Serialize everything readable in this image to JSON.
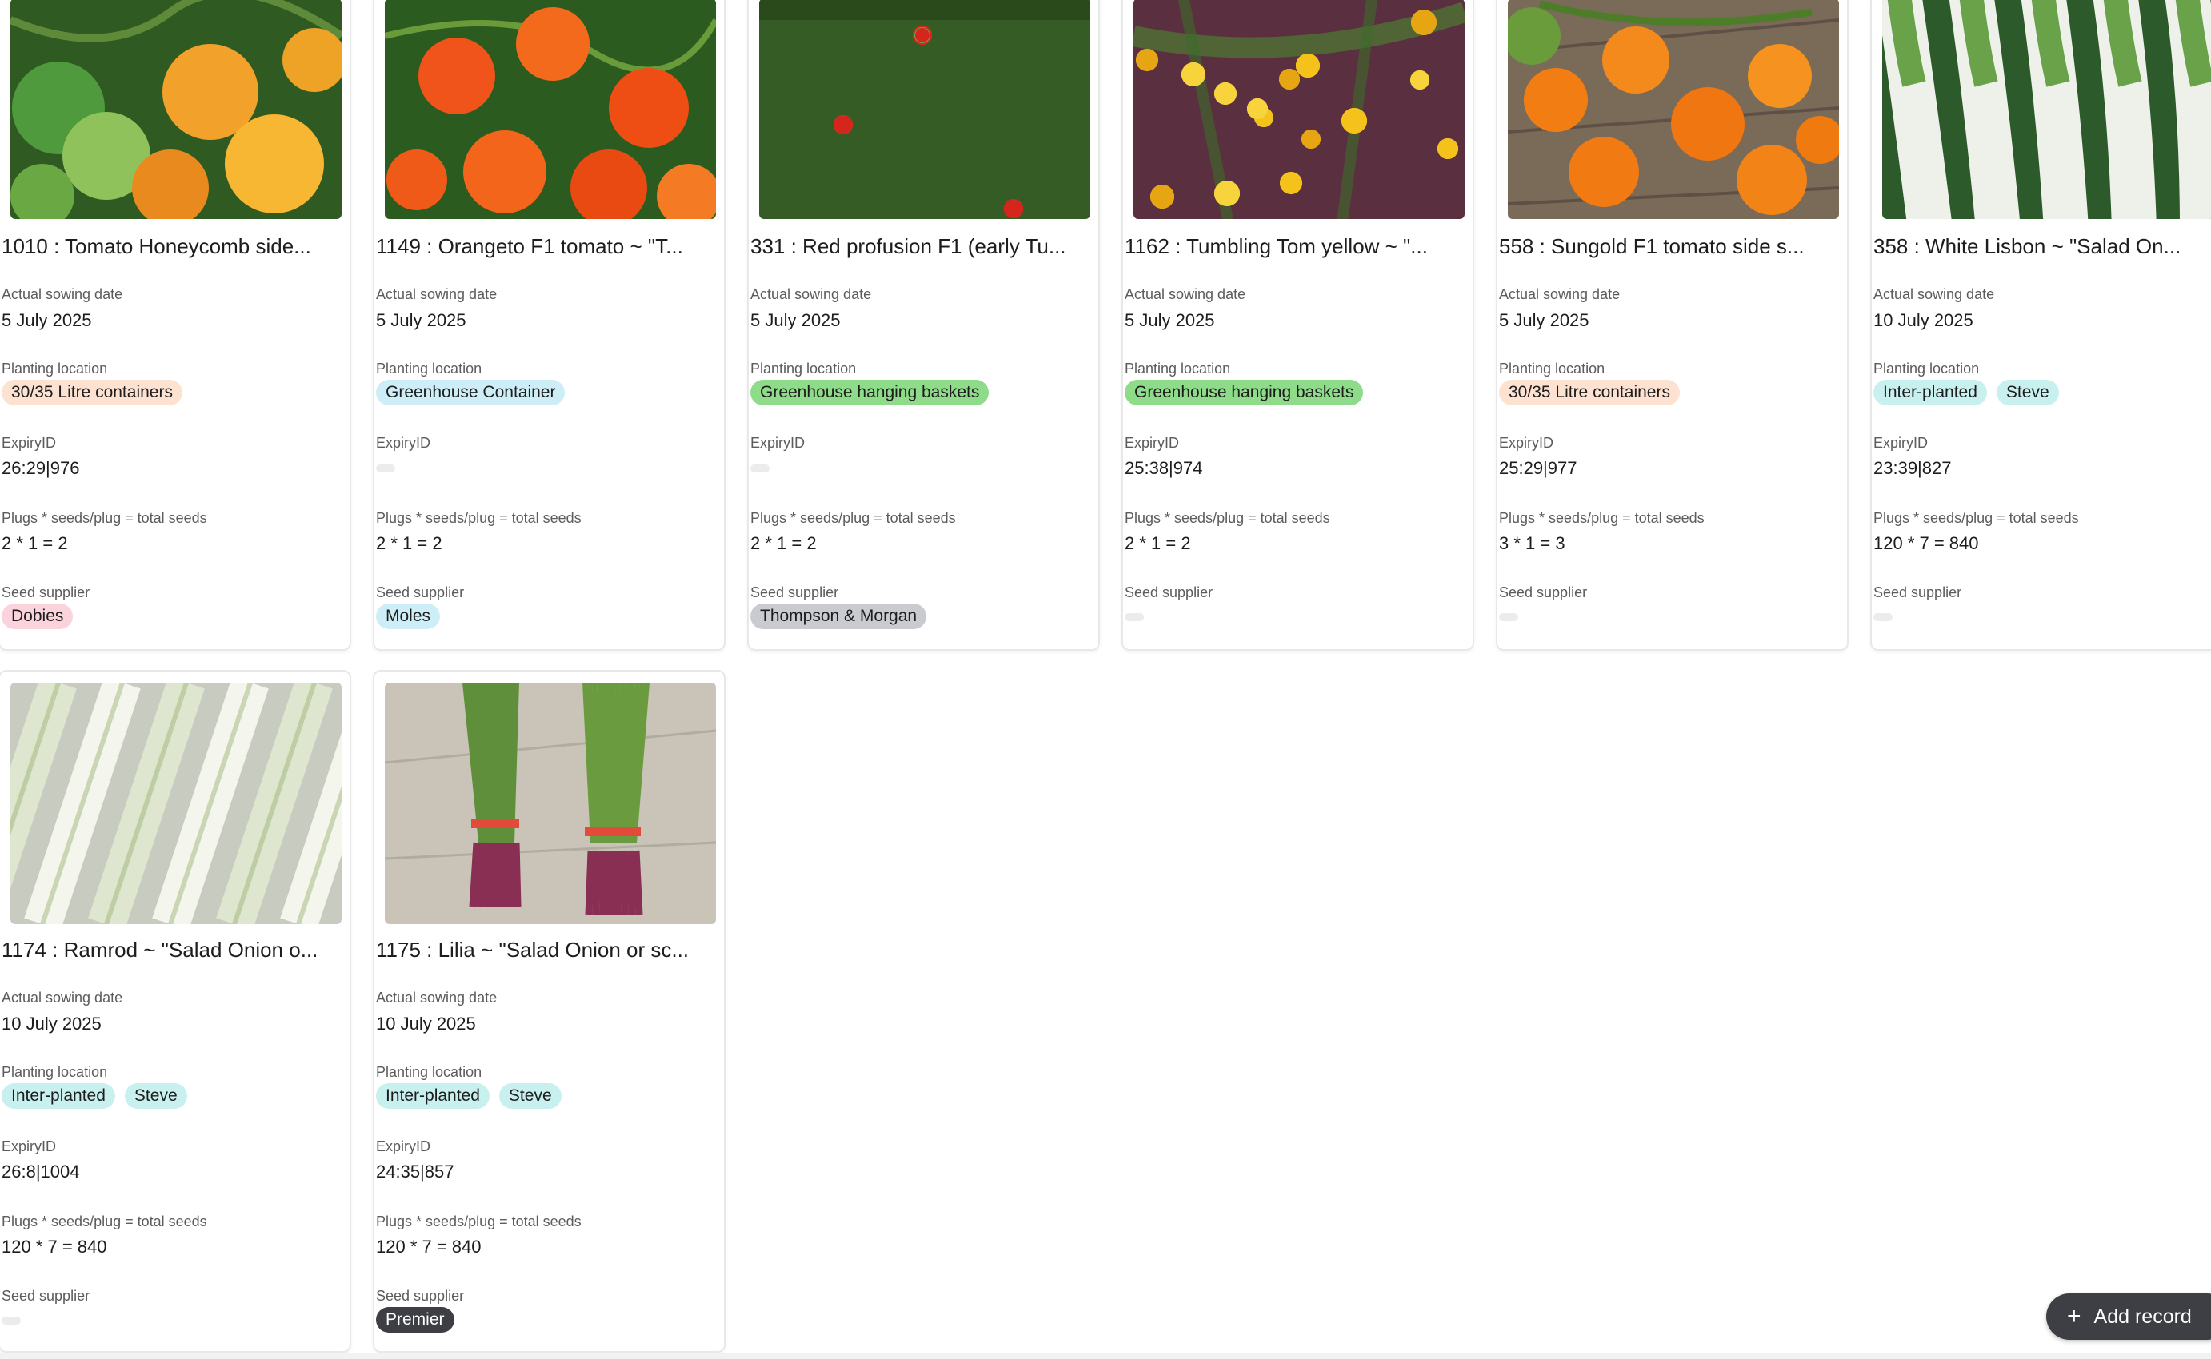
{
  "labels": {
    "sowing_date": "Actual sowing date",
    "planting_location": "Planting location",
    "expiry_id": "ExpiryID",
    "seeds_formula": "Plugs * seeds/plug = total seeds",
    "seed_supplier": "Seed supplier"
  },
  "add_record_label": "Add record",
  "colors": {
    "chip_orange": "#fde2d2",
    "chip_blue": "#cdeef7",
    "chip_green": "#8edc8a",
    "chip_teal": "#c8f0ee",
    "chip_pink": "#fbd3dd",
    "chip_gray": "#c9cbd0",
    "chip_dark": "#3d3f45",
    "add_button": "#3d3f45"
  },
  "cards": [
    {
      "title": "1010 : Tomato Honeycomb side...",
      "image": "orange-green-cherry-tomatoes",
      "sowing_date": "5 July 2025",
      "locations": [
        {
          "label": "30/35 Litre containers",
          "color": "#fde2d2"
        }
      ],
      "expiry_id": "26:29|976",
      "seeds": "2 * 1 = 2",
      "suppliers": [
        {
          "label": "Dobies",
          "color": "#fbd3dd"
        }
      ]
    },
    {
      "title": "1149 : Orangeto F1 tomato ~ \"T...",
      "image": "orange-cherry-tomatoes",
      "sowing_date": "5 July 2025",
      "locations": [
        {
          "label": "Greenhouse Container",
          "color": "#cdeef7"
        }
      ],
      "expiry_id": "",
      "seeds": "2 * 1 = 2",
      "suppliers": [
        {
          "label": "Moles",
          "color": "#cdeef7"
        }
      ]
    },
    {
      "title": "331 : Red profusion F1 (early Tu...",
      "image": "red-tumbling-tomato-plant",
      "sowing_date": "5 July 2025",
      "locations": [
        {
          "label": "Greenhouse hanging baskets",
          "color": "#8edc8a"
        }
      ],
      "expiry_id": "",
      "seeds": "2 * 1 = 2",
      "suppliers": [
        {
          "label": "Thompson & Morgan",
          "color": "#c9cbd0"
        }
      ]
    },
    {
      "title": "1162 : Tumbling Tom yellow ~ \"...",
      "image": "yellow-tumbling-tomatoes",
      "sowing_date": "5 July 2025",
      "locations": [
        {
          "label": "Greenhouse hanging baskets",
          "color": "#8edc8a"
        }
      ],
      "expiry_id": "25:38|974",
      "seeds": "2 * 1 = 2",
      "suppliers": []
    },
    {
      "title": "558 : Sungold F1 tomato side s...",
      "image": "sungold-tomatoes-on-wood",
      "sowing_date": "5 July 2025",
      "locations": [
        {
          "label": "30/35 Litre containers",
          "color": "#fde2d2"
        }
      ],
      "expiry_id": "25:29|977",
      "seeds": "3 * 1 = 3",
      "suppliers": []
    },
    {
      "title": "358 : White Lisbon ~ \"Salad On...",
      "image": "white-spring-onions",
      "sowing_date": "10 July 2025",
      "locations": [
        {
          "label": "Inter-planted",
          "color": "#c8f0ee"
        },
        {
          "label": "Steve",
          "color": "#c8f0ee"
        }
      ],
      "expiry_id": "23:39|827",
      "seeds": "120 * 7 = 840",
      "suppliers": []
    },
    {
      "title": "1174 : Ramrod ~ \"Salad Onion o...",
      "image": "ramrod-onion-stalks",
      "sowing_date": "10 July 2025",
      "locations": [
        {
          "label": "Inter-planted",
          "color": "#c8f0ee"
        },
        {
          "label": "Steve",
          "color": "#c8f0ee"
        }
      ],
      "expiry_id": "26:8|1004",
      "seeds": "120 * 7 = 840",
      "suppliers": []
    },
    {
      "title": "1175 : Lilia ~ \"Salad Onion or sc...",
      "image": "red-salad-onion-bunches",
      "sowing_date": "10 July 2025",
      "locations": [
        {
          "label": "Inter-planted",
          "color": "#c8f0ee"
        },
        {
          "label": "Steve",
          "color": "#c8f0ee"
        }
      ],
      "expiry_id": "24:35|857",
      "seeds": "120 * 7 = 840",
      "suppliers": [
        {
          "label": "Premier",
          "color": "#3d3f45",
          "text_color": "#ffffff"
        }
      ]
    }
  ]
}
